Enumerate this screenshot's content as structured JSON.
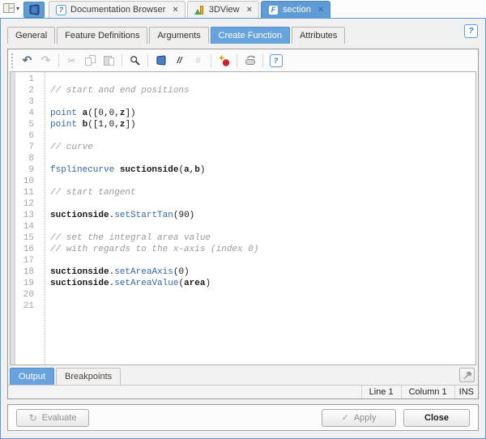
{
  "window_bar": {
    "layout_menu": {
      "caret_glyph": "▾"
    },
    "tabs": [
      {
        "label": "Documentation Browser",
        "icon": "help-badge",
        "badge": "?",
        "close": "×",
        "active": false
      },
      {
        "label": "3DView",
        "icon": "axes-chart",
        "badge": "",
        "close": "×",
        "active": false
      },
      {
        "label": "section",
        "icon": "function-badge",
        "badge": "F",
        "close": "×",
        "active": true
      }
    ]
  },
  "dialog": {
    "tabs": [
      {
        "label": "General",
        "active": false
      },
      {
        "label": "Feature Definitions",
        "active": false
      },
      {
        "label": "Arguments",
        "active": false
      },
      {
        "label": "Create Function",
        "active": true
      },
      {
        "label": "Attributes",
        "active": false
      }
    ],
    "help_glyph": "?"
  },
  "toolbar": {
    "icons": [
      "undo-icon",
      "redo-icon",
      "cut-icon",
      "copy-icon",
      "paste-icon",
      "search-icon",
      "prism-view-icon",
      "comment-icon",
      "uncomment-icon",
      "add-breakpoint-icon",
      "delete-breakpoints-icon",
      "help-icon"
    ],
    "undo_glyph": "↶",
    "redo_glyph": "↷",
    "cut_glyph": "✂",
    "comment_glyph": "//",
    "uncomment_glyph": "#",
    "help_glyph": "?"
  },
  "editor": {
    "lines": [
      {
        "n": "1",
        "segs": []
      },
      {
        "n": "2",
        "segs": [
          {
            "t": "// start and end positions",
            "s": "cm"
          }
        ]
      },
      {
        "n": "3",
        "segs": []
      },
      {
        "n": "4",
        "segs": [
          {
            "t": "point ",
            "s": "kw"
          },
          {
            "t": "a",
            "s": "id"
          },
          {
            "t": "([0,0,",
            "s": "pl"
          },
          {
            "t": "z",
            "s": "id"
          },
          {
            "t": "])",
            "s": "pl"
          }
        ]
      },
      {
        "n": "5",
        "segs": [
          {
            "t": "point ",
            "s": "kw"
          },
          {
            "t": "b",
            "s": "id"
          },
          {
            "t": "([1,0,",
            "s": "pl"
          },
          {
            "t": "z",
            "s": "id"
          },
          {
            "t": "])",
            "s": "pl"
          }
        ]
      },
      {
        "n": "6",
        "segs": []
      },
      {
        "n": "7",
        "segs": [
          {
            "t": "// curve",
            "s": "cm"
          }
        ]
      },
      {
        "n": "8",
        "segs": []
      },
      {
        "n": "9",
        "segs": [
          {
            "t": "fsplinecurve ",
            "s": "kw"
          },
          {
            "t": "suctionside",
            "s": "id"
          },
          {
            "t": "(",
            "s": "pl"
          },
          {
            "t": "a",
            "s": "id"
          },
          {
            "t": ",",
            "s": "pl"
          },
          {
            "t": "b",
            "s": "id"
          },
          {
            "t": ")",
            "s": "pl"
          }
        ]
      },
      {
        "n": "10",
        "segs": []
      },
      {
        "n": "11",
        "segs": [
          {
            "t": "// start tangent",
            "s": "cm"
          }
        ]
      },
      {
        "n": "12",
        "segs": []
      },
      {
        "n": "13",
        "segs": [
          {
            "t": "suctionside",
            "s": "id"
          },
          {
            "t": ".",
            "s": "pl"
          },
          {
            "t": "setStartTan",
            "s": "fn"
          },
          {
            "t": "(",
            "s": "pl"
          },
          {
            "t": "90",
            "s": "num"
          },
          {
            "t": ")",
            "s": "pl"
          }
        ]
      },
      {
        "n": "14",
        "segs": []
      },
      {
        "n": "15",
        "segs": [
          {
            "t": "// set the integral area value",
            "s": "cm"
          }
        ]
      },
      {
        "n": "16",
        "segs": [
          {
            "t": "// with regards to the x-axis (index 0)",
            "s": "cm"
          }
        ]
      },
      {
        "n": "17",
        "segs": []
      },
      {
        "n": "18",
        "segs": [
          {
            "t": "suctionside",
            "s": "id"
          },
          {
            "t": ".",
            "s": "pl"
          },
          {
            "t": "setAreaAxis",
            "s": "fn"
          },
          {
            "t": "(",
            "s": "pl"
          },
          {
            "t": "0",
            "s": "num"
          },
          {
            "t": ")",
            "s": "pl"
          }
        ]
      },
      {
        "n": "19",
        "segs": [
          {
            "t": "suctionside",
            "s": "id"
          },
          {
            "t": ".",
            "s": "pl"
          },
          {
            "t": "setAreaValue",
            "s": "fn"
          },
          {
            "t": "(",
            "s": "pl"
          },
          {
            "t": "area",
            "s": "id"
          },
          {
            "t": ")",
            "s": "pl"
          }
        ]
      },
      {
        "n": "20",
        "segs": []
      },
      {
        "n": "21",
        "segs": []
      }
    ]
  },
  "output_panel": {
    "tabs": [
      {
        "label": "Output",
        "active": true
      },
      {
        "label": "Breakpoints",
        "active": false
      }
    ]
  },
  "status_bar": {
    "line": "Line 1",
    "column": "Column 1",
    "mode": "INS"
  },
  "footer": {
    "evaluate_label": "Evaluate",
    "evaluate_glyph": "↻",
    "apply_label": "Apply",
    "apply_glyph": "✓",
    "close_label": "Close"
  },
  "colors": {
    "accent_blue": "#5f9bd5",
    "active_tab_blue": "#68a3dd",
    "keyword_blue": "#3465a4",
    "comment_gray": "#9a9a9a",
    "breakpoint_red": "#cc2222",
    "star_yellow": "#d9a400"
  }
}
